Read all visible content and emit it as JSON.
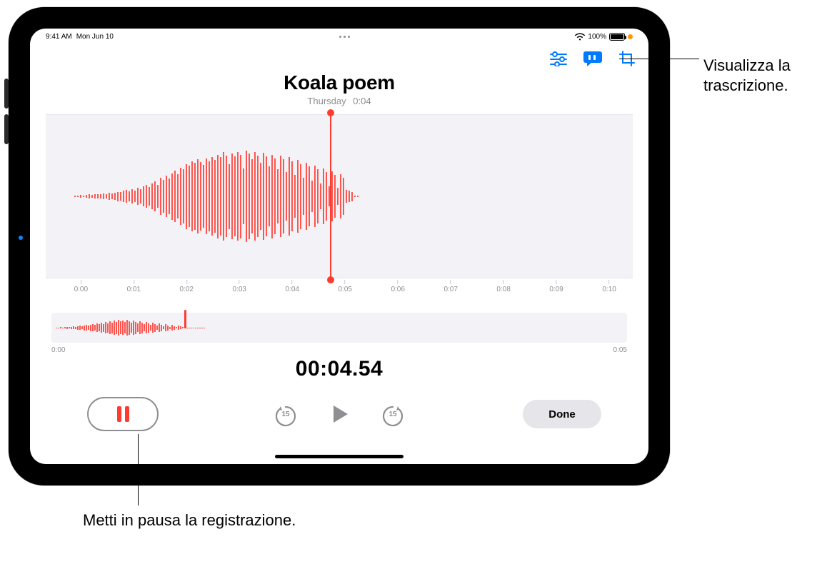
{
  "status": {
    "time": "9:41 AM",
    "date": "Mon Jun 10",
    "battery_pct": "100%"
  },
  "recording": {
    "title": "Koala poem",
    "day": "Thursday",
    "duration": "0:04"
  },
  "ruler": {
    "t0": "0:00",
    "t1": "0:01",
    "t2": "0:02",
    "t3": "0:03",
    "t4": "0:04",
    "t5": "0:05",
    "t6": "0:06",
    "t7": "0:07",
    "t8": "0:08",
    "t9": "0:09",
    "t10": "0:10"
  },
  "overview": {
    "start": "0:00",
    "end": "0:05"
  },
  "timer": "00:04.54",
  "controls": {
    "skip_seconds": "15",
    "done_label": "Done"
  },
  "callouts": {
    "transcription": "Visualizza la trascrizione.",
    "pause": "Metti in pausa la registrazione."
  },
  "colors": {
    "accent_red": "#ff3b30",
    "accent_blue": "#007aff",
    "gray_bg": "#f2f2f7",
    "gray_text": "#8e8e93"
  },
  "icons": {
    "settings": "sliders-icon",
    "transcription": "speech-bubble-quote-icon",
    "crop": "crop-icon"
  }
}
